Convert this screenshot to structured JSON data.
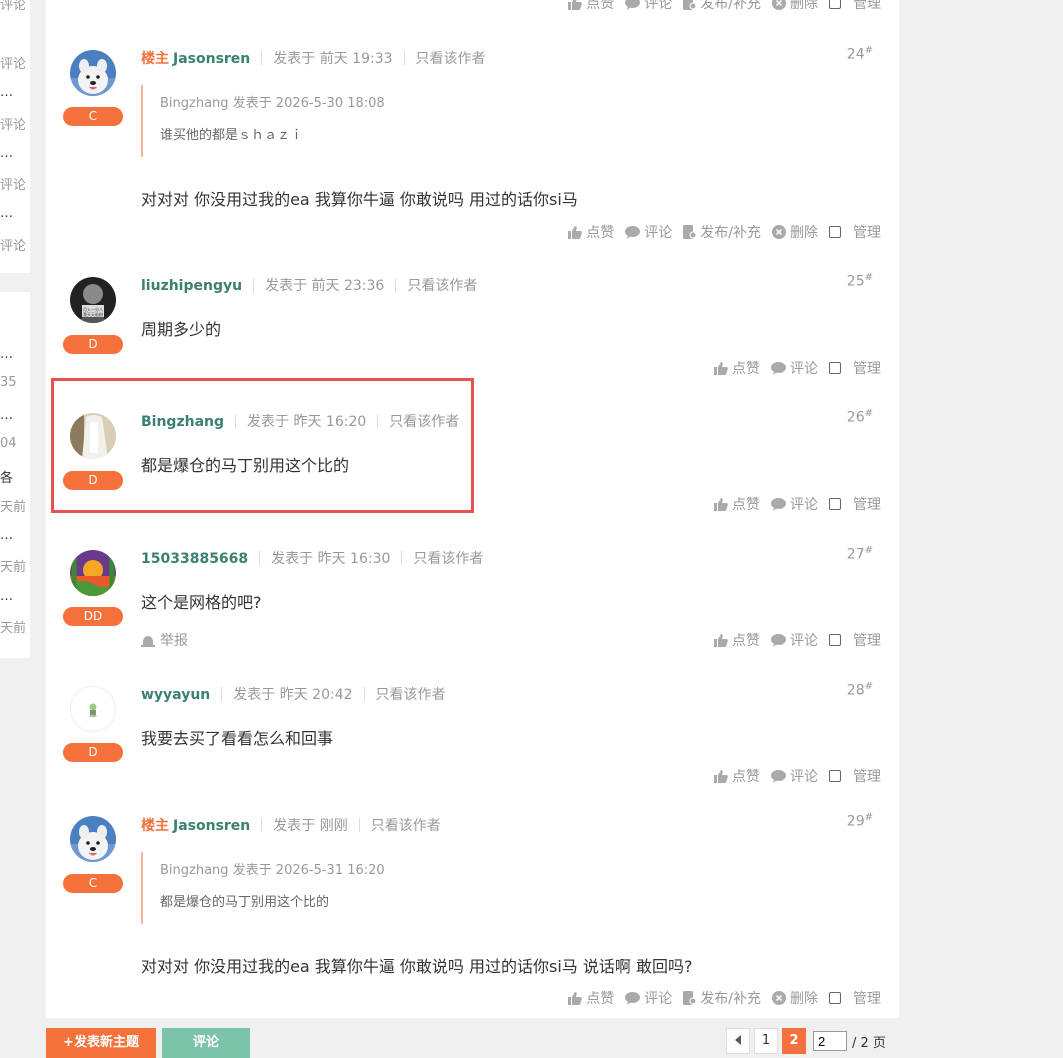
{
  "left_column": {
    "items_top": [
      "评论",
      "评论",
      "…",
      "评论",
      "…",
      "评论",
      "…",
      "评论"
    ],
    "items_bottom": [
      "…",
      "35",
      "…",
      "04",
      "各",
      "天前",
      "…",
      "天前",
      "…",
      "天前"
    ]
  },
  "labels": {
    "op_tag": "楼主",
    "posted_prefix": "发表于",
    "only_author": "只看该作者",
    "like": "点赞",
    "comment": "评论",
    "supplement": "发布/补充",
    "delete": "删除",
    "manage": "管理",
    "report": "举报"
  },
  "top_actions": [
    "点赞",
    "评论",
    "发布/补充",
    "删除",
    "管理"
  ],
  "posts": [
    {
      "floor": "24",
      "username": "Jasonsren",
      "is_op": true,
      "time": "前天 19:33",
      "badge": "C",
      "quote": {
        "head": "Bingzhang 发表于 2026-5-30 18:08",
        "body": "谁买他的都是ｓｈａｚｉ"
      },
      "content": "对对对 你没用过我的ea 我算你牛逼  你敢说吗 用过的话你si马"
    },
    {
      "floor": "25",
      "username": "liuzhipengyu",
      "is_op": false,
      "time": "前天 23:36",
      "badge": "D",
      "content": "周期多少的"
    },
    {
      "floor": "26",
      "username": "Bingzhang",
      "is_op": false,
      "time": "昨天 16:20",
      "badge": "D",
      "content": "都是爆仓的马丁别用这个比的"
    },
    {
      "floor": "27",
      "username": "15033885668",
      "is_op": false,
      "time": "昨天 16:30",
      "badge": "DD",
      "content": "这个是网格的吧?"
    },
    {
      "floor": "28",
      "username": "wyyayun",
      "is_op": false,
      "time": "昨天 20:42",
      "badge": "D",
      "content": "我要去买了看看怎么和回事"
    },
    {
      "floor": "29",
      "username": "Jasonsren",
      "is_op": true,
      "time": "刚刚",
      "badge": "C",
      "quote": {
        "head": "Bingzhang 发表于 2026-5-31 16:20",
        "body": "都是爆仓的马丁别用这个比的"
      },
      "content": "对对对 你没用过我的ea 我算你牛逼  你敢说吗 用过的话你si马 说话啊 敢回吗?"
    }
  ],
  "bottom": {
    "new_topic": "+发表新主题",
    "comment": "评论",
    "pager": {
      "page1": "1",
      "page2": "2",
      "input_value": "2",
      "total": "/ 2 页"
    }
  },
  "colors": {
    "accent": "#f4713c",
    "username": "#3b8070",
    "highlight": "#e4534e",
    "comment_btn": "#7bc4a9"
  }
}
